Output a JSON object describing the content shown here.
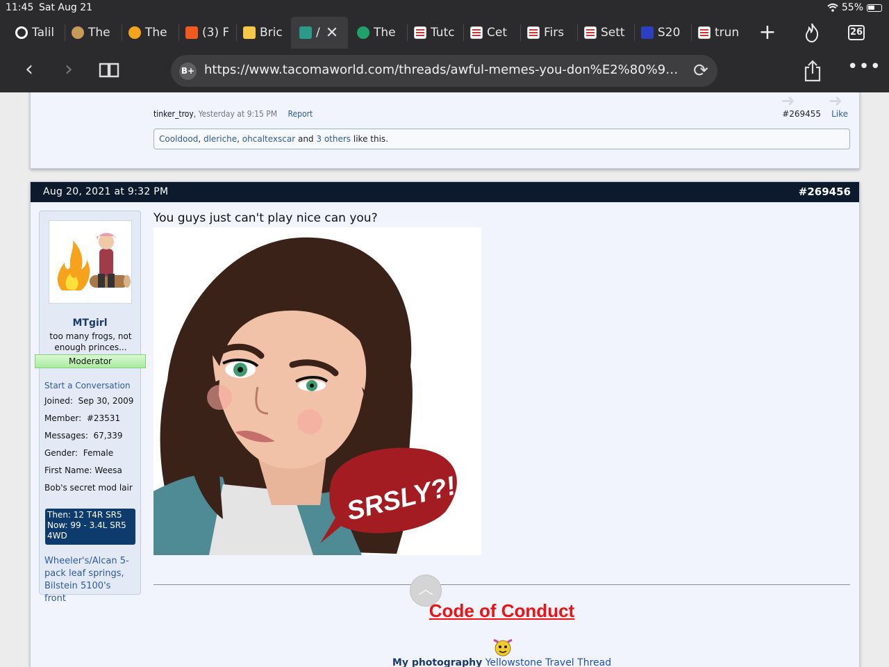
{
  "status_bar": {
    "time": "11:45",
    "date": "Sat Aug 21",
    "battery": "55%",
    "battery_level": 0.55
  },
  "tabs": [
    {
      "label": "Talil",
      "icon": "gear-icon"
    },
    {
      "label": "The",
      "icon": "globe-icon"
    },
    {
      "label": "The",
      "icon": "bee-icon"
    },
    {
      "label": "(3) F",
      "icon": "orange-site-icon"
    },
    {
      "label": "Bric",
      "icon": "hexagon-icon"
    },
    {
      "label": "/",
      "icon": "tacomaworld-icon",
      "active": true
    },
    {
      "label": "The",
      "icon": "green-chat-icon"
    },
    {
      "label": "Tutc",
      "icon": "page-icon"
    },
    {
      "label": "Cet",
      "icon": "page-icon"
    },
    {
      "label": "Firs",
      "icon": "page-icon"
    },
    {
      "label": "Sett",
      "icon": "page-icon"
    },
    {
      "label": "S20",
      "icon": "s-logo-icon"
    },
    {
      "label": "trun",
      "icon": "page-icon"
    }
  ],
  "tab_count": "26",
  "navbar": {
    "url": "https://www.tacomaworld.com/threads/awful-memes-you-don%E2%80%99t-do-t...",
    "url_badge": "B+"
  },
  "prev_post": {
    "author": "tinker_troy",
    "date": "Yesterday at 9:15 PM",
    "report": "Report",
    "number": "#269455",
    "like": "Like",
    "likers": [
      "Cooldood",
      "dleriche",
      "ohcaltexscar"
    ],
    "others": "3 others",
    "likes_tail": "like this."
  },
  "post": {
    "date": "Aug 20, 2021 at 9:32 PM",
    "number": "#269456",
    "message": "You guys just can't play nice can you?",
    "bubble_text": "SRSLY?!",
    "user": {
      "name": "MTgirl",
      "title": "too many frogs, not enough princes...",
      "badge": "Moderator",
      "start_convo": "Start a Conversation",
      "info": [
        {
          "label": "Joined:",
          "value": "Sep 30, 2009"
        },
        {
          "label": "Member:",
          "value": "#23531"
        },
        {
          "label": "Messages:",
          "value": "67,339"
        },
        {
          "label": "Gender:",
          "value": "Female"
        },
        {
          "label": "First Name:",
          "value": "Weesa"
        },
        {
          "label": "Bob's secret mod lair",
          "value": ""
        }
      ],
      "vehicle_lines": [
        "Then: 12 T4R SR5",
        "Now: 99 - 3.4L SR5",
        "4WD"
      ],
      "mods": "Wheeler's/Alcan 5-pack leaf springs, Bilstein 5100's front"
    },
    "signature": {
      "coc": "Code of Conduct",
      "photo_label": "My photography",
      "photo_link": "Yellowstone Travel Thread"
    }
  },
  "colors": {
    "header_bg": "#0d1a2e",
    "link": "#2d5a9e",
    "coc": "#e11111",
    "moderator": "#a9eb9f"
  }
}
